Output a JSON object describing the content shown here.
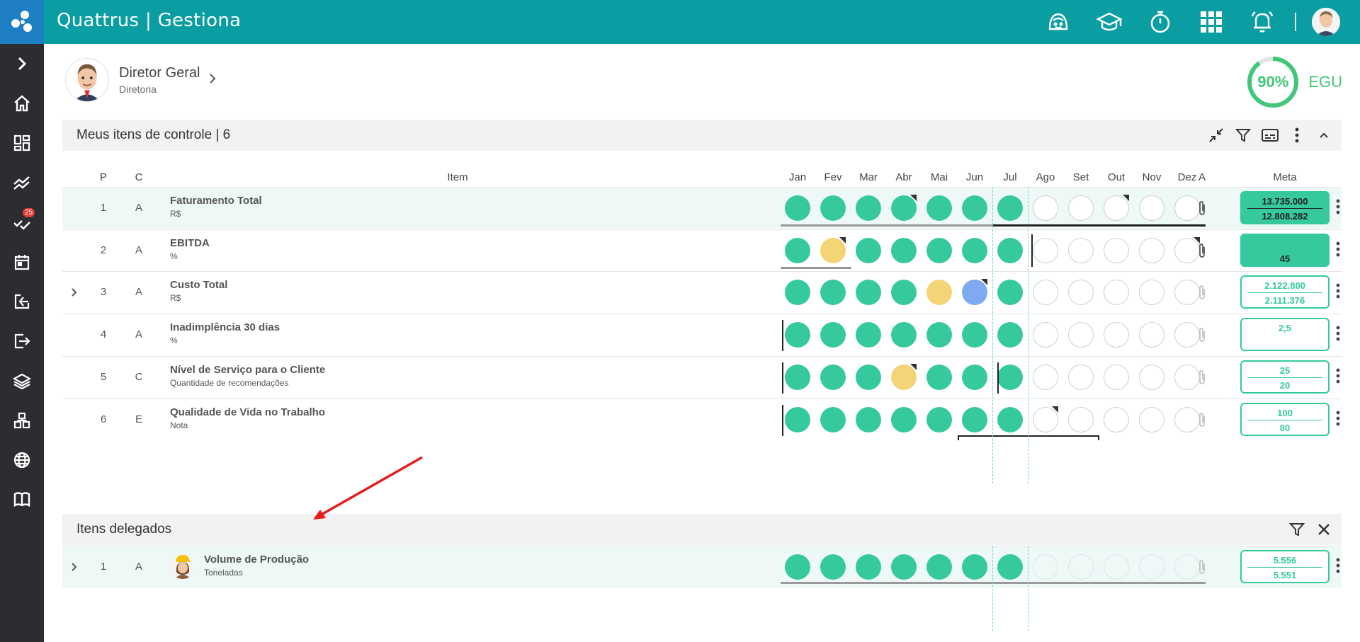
{
  "app": {
    "title": "Quattrus | Gestiona"
  },
  "topbar": {
    "icons": [
      "support-icon",
      "graduation-cap-icon",
      "timer-icon",
      "apps-grid-icon",
      "notification-bell-icon"
    ]
  },
  "sidebar": {
    "items": [
      {
        "name": "expand-icon"
      },
      {
        "name": "home-icon"
      },
      {
        "name": "dashboard-icon"
      },
      {
        "name": "trend-icon"
      },
      {
        "name": "tasks-icon",
        "badge": "25"
      },
      {
        "name": "calendar-icon"
      },
      {
        "name": "login-icon"
      },
      {
        "name": "logout-icon"
      },
      {
        "name": "layers-icon"
      },
      {
        "name": "structure-icon"
      },
      {
        "name": "globe-icon"
      },
      {
        "name": "book-icon"
      }
    ]
  },
  "profile": {
    "name": "Diretor Geral",
    "dept": "Diretoria"
  },
  "score": {
    "value": 0.9,
    "pct_label": "90%",
    "label": "EGU"
  },
  "colors": {
    "green": "#36c99e",
    "yellow": "#f3d477",
    "blue": "#7fa9f0",
    "teal": "#0a9ea3",
    "sidebar": "#2b2d31"
  },
  "control": {
    "title": "Meus itens de controle | 6",
    "headers": {
      "p": "P",
      "c": "C",
      "item": "Item",
      "a": "A",
      "meta": "Meta"
    },
    "months": [
      "Jan",
      "Fev",
      "Mar",
      "Abr",
      "Mai",
      "Jun",
      "Jul",
      "Ago",
      "Set",
      "Out",
      "Nov",
      "Dez"
    ],
    "rows": [
      {
        "p": "1",
        "c": "A",
        "name": "Faturamento Total",
        "unit": "R$",
        "expandable": false,
        "highlight": true,
        "statuses": [
          "g",
          "g",
          "g",
          "g",
          "g",
          "g",
          "g",
          "e",
          "e",
          "e",
          "e",
          "e"
        ],
        "corners": [
          3,
          9
        ],
        "meta_top": "13.735.000",
        "meta_bottom": "12.808.282",
        "meta_solid": true,
        "clip_active": true
      },
      {
        "p": "2",
        "c": "A",
        "name": "EBITDA",
        "unit": "%",
        "expandable": false,
        "highlight": false,
        "statuses": [
          "g",
          "y",
          "g",
          "g",
          "g",
          "g",
          "g",
          "e",
          "e",
          "e",
          "e",
          "e"
        ],
        "corners": [
          1,
          11
        ],
        "meta_top": "",
        "meta_bottom": "45",
        "meta_solid": true,
        "clip_active": true
      },
      {
        "p": "3",
        "c": "A",
        "name": "Custo Total",
        "unit": "R$",
        "expandable": true,
        "highlight": false,
        "statuses": [
          "g",
          "g",
          "g",
          "g",
          "y",
          "b",
          "g",
          "e",
          "e",
          "e",
          "e",
          "e"
        ],
        "corners": [
          5
        ],
        "meta_top": "2.122.800",
        "meta_bottom": "2.111.376",
        "meta_solid": false,
        "clip_active": false
      },
      {
        "p": "4",
        "c": "A",
        "name": "Inadimplência 30 dias",
        "unit": "%",
        "expandable": false,
        "highlight": false,
        "statuses": [
          "g",
          "g",
          "g",
          "g",
          "g",
          "g",
          "g",
          "e",
          "e",
          "e",
          "e",
          "e"
        ],
        "corners": [],
        "meta_top": "2,5",
        "meta_bottom": "",
        "meta_solid": false,
        "clip_active": false
      },
      {
        "p": "5",
        "c": "C",
        "name": "Nível de Serviço para o Cliente",
        "unit": "Quantidade de recomendações",
        "expandable": false,
        "highlight": false,
        "statuses": [
          "g",
          "g",
          "g",
          "y",
          "g",
          "g",
          "g",
          "e",
          "e",
          "e",
          "e",
          "e"
        ],
        "corners": [
          3
        ],
        "meta_top": "25",
        "meta_bottom": "20",
        "meta_solid": false,
        "clip_active": false
      },
      {
        "p": "6",
        "c": "E",
        "name": "Qualidade de Vida no Trabalho",
        "unit": "Nota",
        "expandable": false,
        "highlight": false,
        "statuses": [
          "g",
          "g",
          "g",
          "g",
          "g",
          "g",
          "g",
          "e",
          "e",
          "e",
          "e",
          "e"
        ],
        "corners": [
          7
        ],
        "meta_top": "100",
        "meta_bottom": "80",
        "meta_solid": false,
        "clip_active": false
      }
    ]
  },
  "delegated": {
    "title": "Itens delegados",
    "rows": [
      {
        "p": "1",
        "c": "A",
        "name": "Volume de Produção",
        "unit": "Toneladas",
        "expandable": true,
        "statuses": [
          "g",
          "g",
          "g",
          "g",
          "g",
          "g",
          "g",
          "f",
          "f",
          "f",
          "f",
          "f"
        ],
        "corners": [],
        "meta_top": "5.556",
        "meta_bottom": "5.551"
      }
    ]
  }
}
